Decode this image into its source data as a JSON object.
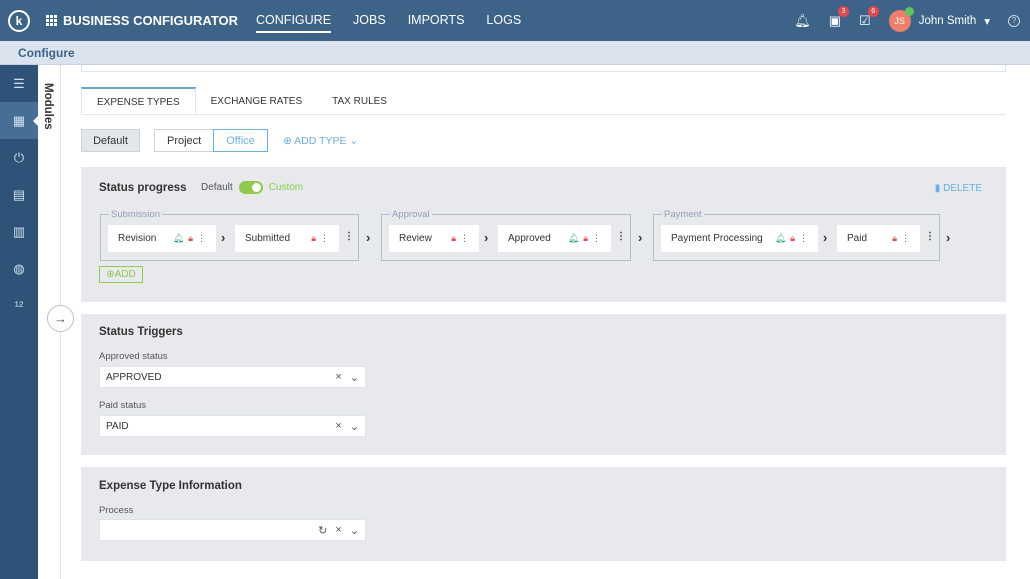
{
  "app": {
    "title": "BUSINESS CONFIGURATOR",
    "logo": "k"
  },
  "nav": {
    "items": [
      "CONFIGURE",
      "JOBS",
      "IMPORTS",
      "LOGS"
    ],
    "active": "CONFIGURE"
  },
  "topbar": {
    "badges": {
      "calendar": "3",
      "tasks": "6"
    },
    "user": {
      "initials": "JS",
      "name": "John Smith"
    }
  },
  "breadcrumb": "Configure",
  "modules": {
    "label": "Modules"
  },
  "tabs": [
    "EXPENSE TYPES",
    "EXCHANGE RATES",
    "TAX RULES"
  ],
  "type_selector": {
    "default_label": "Default",
    "options": [
      "Project",
      "Office"
    ],
    "selected": "Office",
    "add_type": "ADD TYPE"
  },
  "status_progress": {
    "title": "Status progress",
    "default_label": "Default",
    "custom_label": "Custom",
    "delete_label": "DELETE",
    "add_label": "ADD",
    "groups": [
      {
        "label": "Submission",
        "statuses": [
          "Revision",
          "Submitted"
        ]
      },
      {
        "label": "Approval",
        "statuses": [
          "Review",
          "Approved"
        ]
      },
      {
        "label": "Payment",
        "statuses": [
          "Payment Processing",
          "Paid"
        ]
      }
    ]
  },
  "status_triggers": {
    "title": "Status Triggers",
    "approved_label": "Approved status",
    "approved_value": "APPROVED",
    "paid_label": "Paid status",
    "paid_value": "PAID"
  },
  "expense_info": {
    "title": "Expense Type Information",
    "process_label": "Process",
    "process_value": ""
  },
  "colors": {
    "topbar": "#3d6389",
    "sidebar": "#2f5378",
    "accent": "#6ab0e4",
    "toggle": "#8fca4a",
    "bell": "#2aa888",
    "lock": "#e5484d"
  }
}
